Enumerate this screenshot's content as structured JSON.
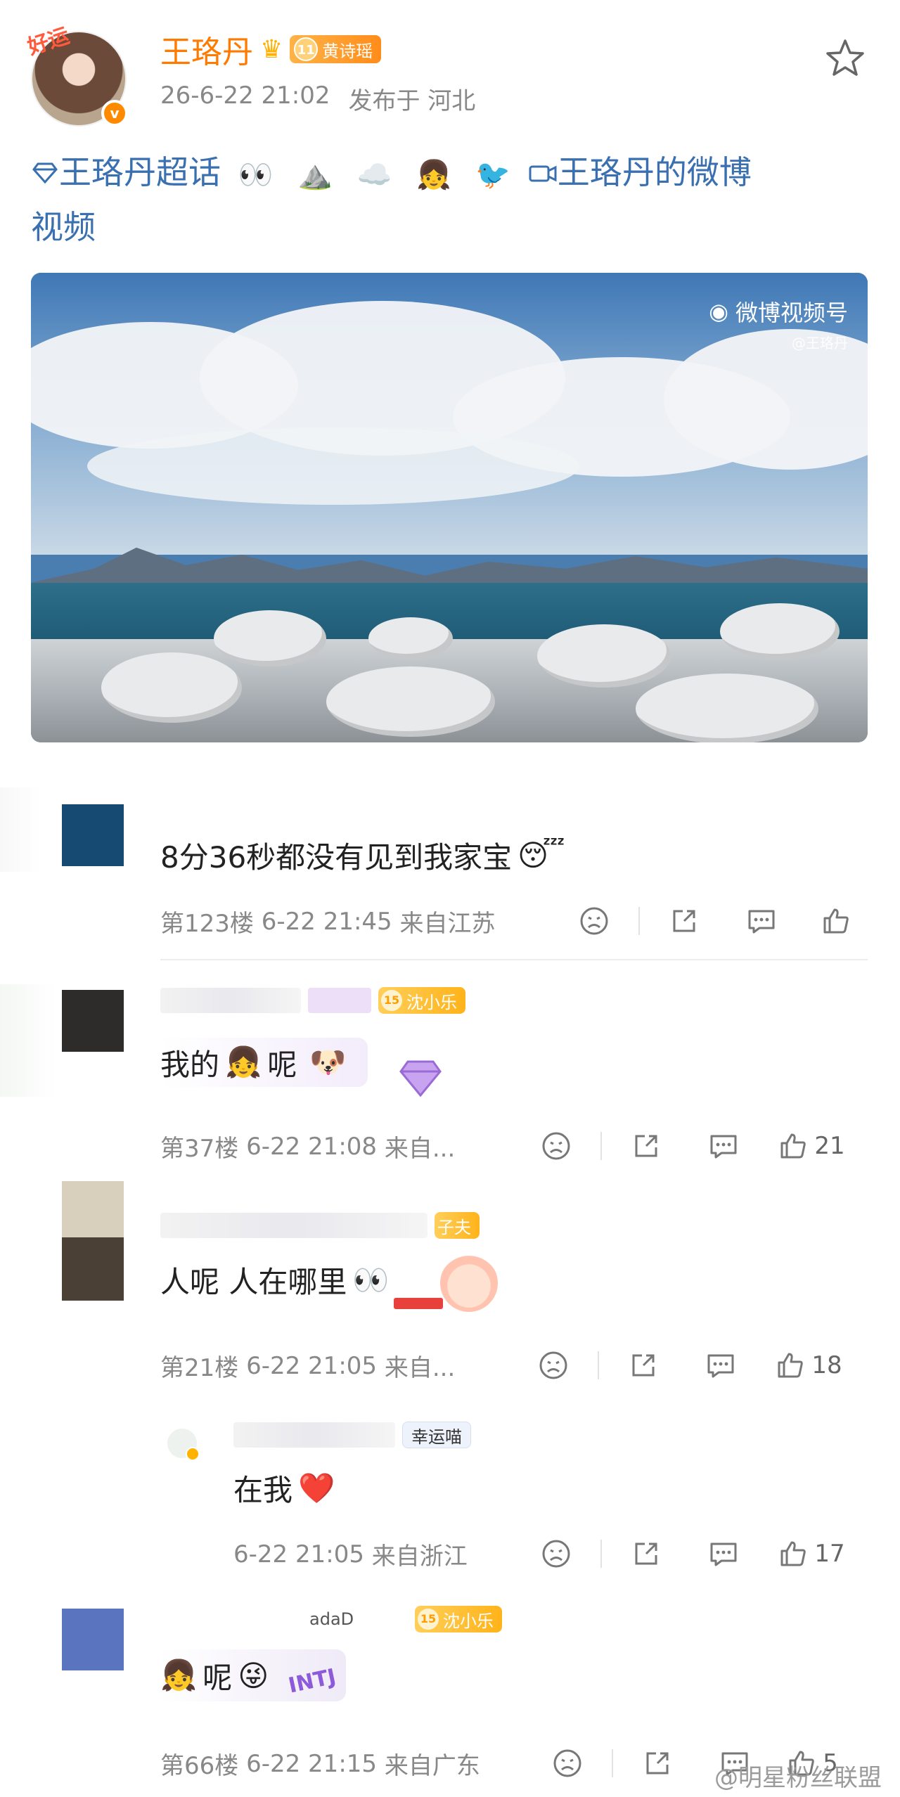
{
  "post": {
    "avatar_tag": "好运",
    "author": "王珞丹",
    "fan_badge_level": "11",
    "fan_badge_name": "黄诗瑶",
    "date": "26-6-22 21:02",
    "location": "发布于 河北",
    "topic": "王珞丹超话",
    "video_link": "王珞丹的微博",
    "video_link_suffix": "视频",
    "emojis": [
      "👀",
      "⛰️",
      "☁️",
      "👧",
      "🐦"
    ]
  },
  "video": {
    "watermark_title": "微博视频号",
    "watermark_handle": "@王珞丹"
  },
  "comments": [
    {
      "text": "8分36秒都没有见到我家宝",
      "emoji": "😴",
      "floor": "第123楼",
      "time": "6-22 21:45",
      "from": "来自江苏",
      "likes": ""
    },
    {
      "badge_level": "15",
      "badge_name": "沈小乐",
      "text": "我的",
      "emoji1": "👧",
      "text2": "呢",
      "emoji2": "🐶",
      "floor": "第37楼",
      "time": "6-22 21:08",
      "from": "来自...",
      "likes": "21"
    },
    {
      "badge_name": "子夫",
      "text": "人呢 人在哪里",
      "emoji": "👀",
      "floor": "第21楼",
      "time": "6-22 21:05",
      "from": "来自...",
      "likes": "18"
    },
    {
      "badge_name": "幸运喵",
      "text": "在我",
      "emoji": "❤️",
      "time": "6-22 21:05",
      "from": "来自浙江",
      "likes": "17"
    },
    {
      "name_fragment": "adaD",
      "badge_level": "15",
      "badge_name": "沈小乐",
      "emoji1": "👧",
      "text": "呢",
      "emoji2": "😜",
      "sticker_text": "INTJ",
      "floor": "第66楼",
      "time": "6-22 21:15",
      "from": "来自广东",
      "likes": "5"
    }
  ],
  "footer_watermark": "@明星粉丝联盟"
}
